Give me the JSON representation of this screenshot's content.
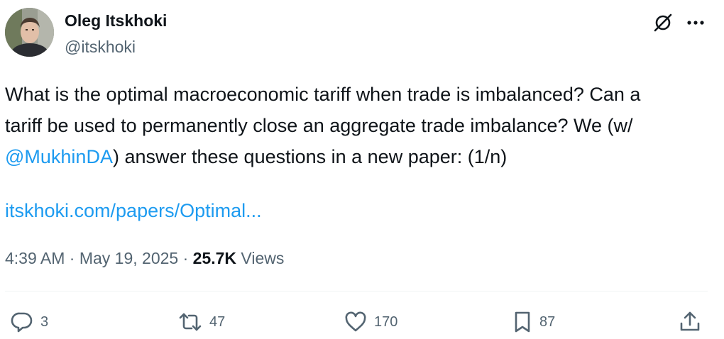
{
  "author": {
    "name": "Oleg Itskhoki",
    "handle": "@itskhoki"
  },
  "tweet": {
    "line1": "What is the optimal macroeconomic tariff when trade is imbalanced? Can a",
    "line2": "tariff be used to permanently close an aggregate trade imbalance? We (w/",
    "mention": "@MukhinDA",
    "line3_rest": ") answer these questions in a new paper: (1/n)",
    "link": "itskhoki.com/papers/Optimal..."
  },
  "meta": {
    "time": "4:39 AM",
    "separator1": " · ",
    "date": "May 19, 2025",
    "separator2": " · ",
    "views_count": "25.7K",
    "views_label": " Views"
  },
  "actions": {
    "replies": "3",
    "retweets": "47",
    "likes": "170",
    "bookmarks": "87"
  },
  "colors": {
    "text": "#0f1419",
    "secondary": "#536471",
    "accent": "#1d9bf0",
    "divider": "#eff3f4"
  },
  "icons": {
    "grok": "grok-icon",
    "more": "more-icon",
    "reply": "reply-icon",
    "retweet": "retweet-icon",
    "like": "heart-icon",
    "bookmark": "bookmark-icon",
    "share": "share-icon"
  }
}
